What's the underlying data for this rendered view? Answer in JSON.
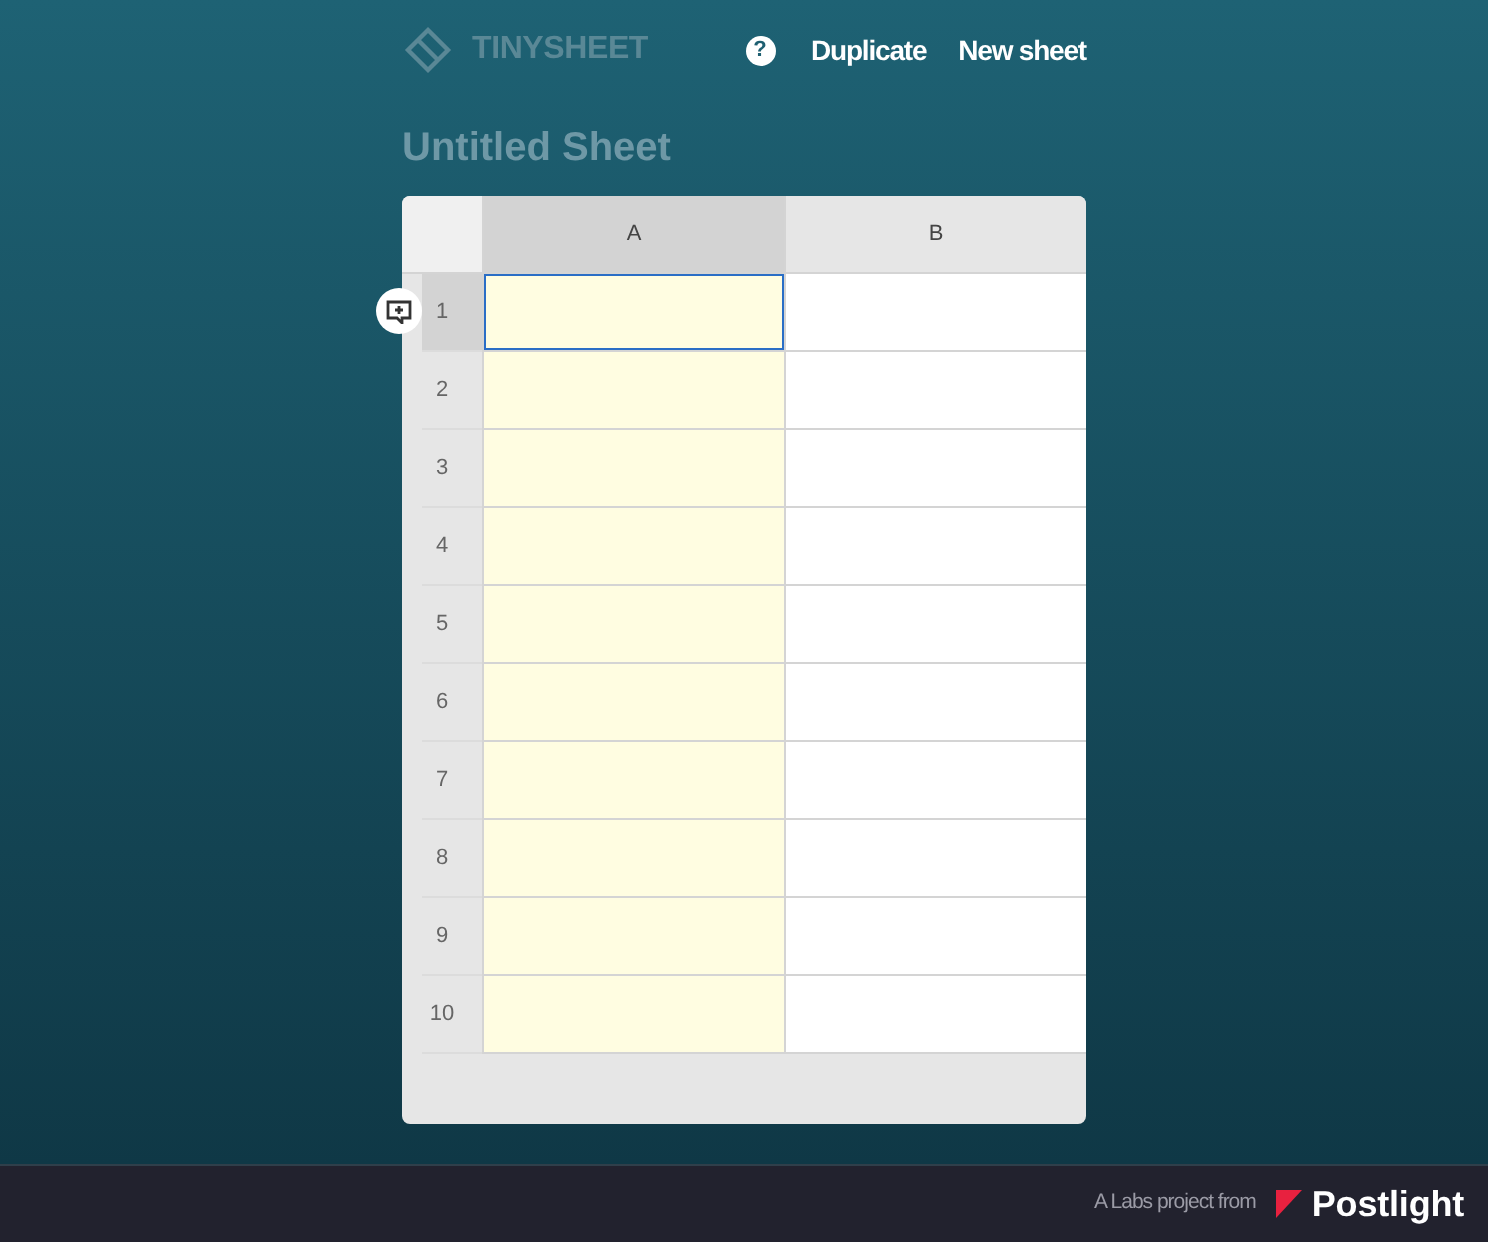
{
  "app_bar": {
    "logo_text": "TINYSHEET",
    "help_button": "?",
    "actions": [
      "Duplicate",
      "New sheet"
    ]
  },
  "sheet": {
    "title": "Untitled Sheet",
    "columns": [
      {
        "label": "A",
        "selected": true
      },
      {
        "label": "B",
        "selected": false
      }
    ],
    "rows": [
      {
        "label": "1",
        "selected": true,
        "cells": [
          {
            "active": true
          },
          {
            "active": false
          }
        ]
      },
      {
        "label": "2",
        "selected": false,
        "cells": [
          {
            "active": false
          },
          {
            "active": false
          }
        ]
      },
      {
        "label": "3",
        "selected": false,
        "cells": [
          {
            "active": false
          },
          {
            "active": false
          }
        ]
      },
      {
        "label": "4",
        "selected": false,
        "cells": [
          {
            "active": false
          },
          {
            "active": false
          }
        ]
      },
      {
        "label": "5",
        "selected": false,
        "cells": [
          {
            "active": false
          },
          {
            "active": false
          }
        ]
      },
      {
        "label": "6",
        "selected": false,
        "cells": [
          {
            "active": false
          },
          {
            "active": false
          }
        ]
      },
      {
        "label": "7",
        "selected": false,
        "cells": [
          {
            "active": false
          },
          {
            "active": false
          }
        ]
      },
      {
        "label": "8",
        "selected": false,
        "cells": [
          {
            "active": false
          },
          {
            "active": false
          }
        ]
      },
      {
        "label": "9",
        "selected": false,
        "cells": [
          {
            "active": false
          },
          {
            "active": false
          }
        ]
      },
      {
        "label": "10",
        "selected": false,
        "cells": [
          {
            "active": false
          },
          {
            "active": false
          }
        ]
      }
    ]
  },
  "footer": {
    "credit": "A Labs project from",
    "brand": "Postlight"
  }
}
